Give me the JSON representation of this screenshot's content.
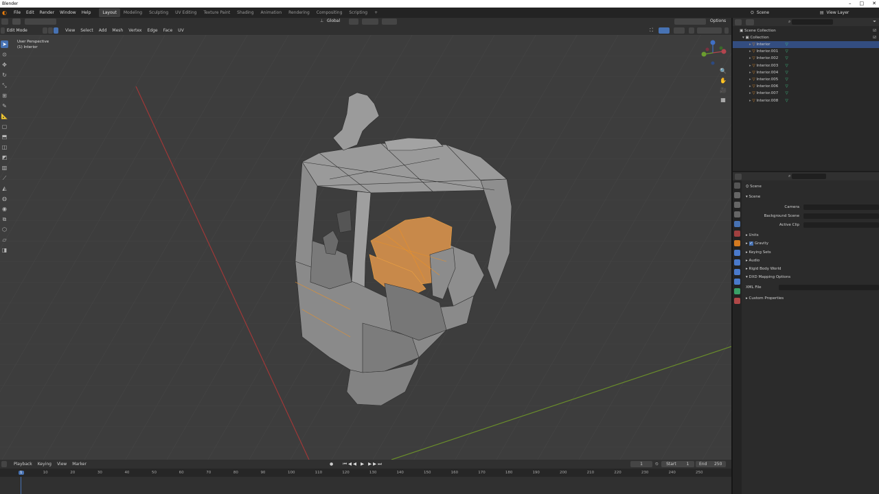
{
  "os": {
    "title": "Blender"
  },
  "menu": [
    "File",
    "Edit",
    "Render",
    "Window",
    "Help"
  ],
  "workspaces": [
    "Layout",
    "Modeling",
    "Sculpting",
    "UV Editing",
    "Texture Paint",
    "Shading",
    "Animation",
    "Rendering",
    "Compositing",
    "Scripting"
  ],
  "topbar": {
    "add_tab": "+",
    "scene": "Scene",
    "view_layer": "View Layer"
  },
  "viewport": {
    "mode": "Edit Mode",
    "menus": [
      "View",
      "Select",
      "Add",
      "Mesh",
      "Vertex",
      "Edge",
      "Face",
      "UV"
    ],
    "transform_orientation": "Global",
    "options": "Options",
    "perspective": "User Perspective",
    "object": "(1) Interior",
    "gizmo": {
      "x": "X",
      "y": "Y",
      "z": "Z"
    }
  },
  "outliner": {
    "root": "Scene Collection",
    "collection": "Collection",
    "objects": [
      "Interior",
      "Interior.001",
      "Interior.002",
      "Interior.003",
      "Interior.004",
      "Interior.005",
      "Interior.006",
      "Interior.007",
      "Interior.008"
    ]
  },
  "properties": {
    "title": "Scene",
    "section": "Scene",
    "camera_label": "Camera",
    "bg_scene_label": "Background Scene",
    "active_clip_label": "Active Clip",
    "panels": [
      "Units",
      "Gravity",
      "Keying Sets",
      "Audio",
      "Rigid Body World",
      "DXD Mapping Options",
      "Custom Properties"
    ],
    "xml_file_label": "XML File"
  },
  "timeline": {
    "menus": [
      "Playback",
      "Keying",
      "View",
      "Marker"
    ],
    "current_frame": "1",
    "start_label": "Start",
    "start_value": "1",
    "end_label": "End",
    "end_value": "250",
    "ticks": [
      "1",
      "10",
      "20",
      "30",
      "40",
      "50",
      "60",
      "70",
      "80",
      "90",
      "100",
      "110",
      "120",
      "130",
      "140",
      "150",
      "160",
      "170",
      "180",
      "190",
      "200",
      "210",
      "220",
      "230",
      "240",
      "250"
    ]
  },
  "colors": {
    "accent": "#4772b3",
    "selection": "#e8912a",
    "x_axis": "#b34141",
    "y_axis": "#6f9a2e"
  }
}
